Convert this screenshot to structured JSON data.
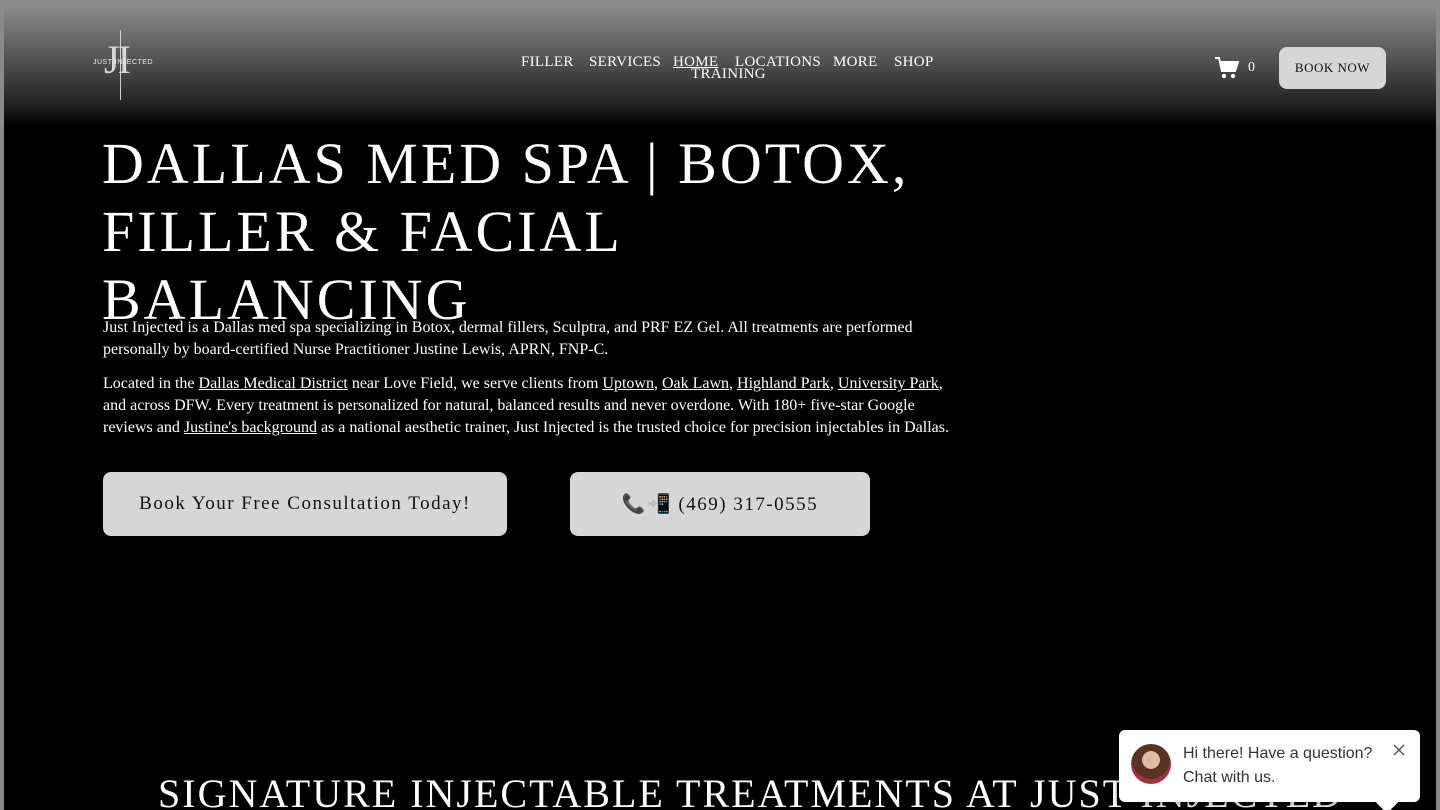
{
  "header": {
    "logo": {
      "monogram": "JI",
      "wordmark": "JUST INJECTED"
    },
    "nav": [
      {
        "label": "FILLER"
      },
      {
        "label": "SERVICES"
      },
      {
        "label": "HOME",
        "active": true
      },
      {
        "label": "LOCATIONS"
      },
      {
        "label": "MORE"
      },
      {
        "label": "SHOP"
      },
      {
        "label": "TRAINING"
      }
    ],
    "cart_count": "0",
    "cart_icon": "cart-icon",
    "book_now": "BOOK NOW"
  },
  "hero": {
    "title_line1": "DALLAS MED SPA | BOTOX,",
    "title_line2": "FILLER & FACIAL BALANCING",
    "p1": "Just Injected is a Dallas med spa specializing in Botox, dermal fillers, Sculptra, and PRF EZ Gel. All treatments are performed personally by board-certified Nurse Practitioner Justine Lewis, APRN, FNP-C.",
    "p2": {
      "t1": "Located in the ",
      "link_medical_district": "Dallas Medical District",
      "t2": " near Love Field, we serve clients from ",
      "link_uptown": "Uptown",
      "sep1": ", ",
      "link_oak_lawn": "Oak Lawn",
      "sep2": ", ",
      "link_highland_park": "Highland Park",
      "sep3": ", ",
      "link_university_park": "University Park",
      "t3": ", and across DFW. Every treatment is personalized for natural, balanced results and never overdone. With 180+ five-star Google reviews and ",
      "link_background": "Justine's background",
      "t4": " as a national aesthetic trainer, Just Injected is the trusted choice for precision injectables in Dallas."
    },
    "cta_consult": "Book Your Free Consultation Today!",
    "cta_phone": "📞📲 (469) 317-0555"
  },
  "section": {
    "title": "SIGNATURE INJECTABLE TREATMENTS AT JUST INJECTED"
  },
  "chat": {
    "message": "Hi there! Have a question? Chat with us.",
    "close_icon": "close-icon"
  }
}
